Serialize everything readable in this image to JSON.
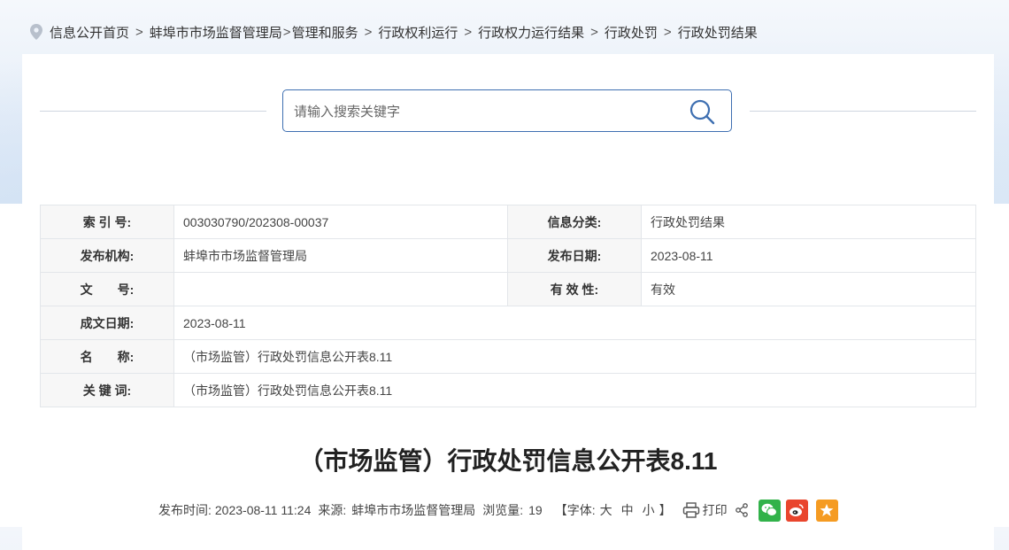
{
  "breadcrumb": {
    "items": [
      "信息公开首页",
      "蚌埠市市场监督管理局",
      "管理和服务",
      "行政权利运行",
      "行政权力运行结果",
      "行政处罚",
      "行政处罚结果"
    ],
    "separator": ">"
  },
  "search": {
    "placeholder": "请输入搜索关键字",
    "value": ""
  },
  "meta": {
    "index_label": "索 引 号:",
    "index_value": "003030790/202308-00037",
    "category_label": "信息分类:",
    "category_value": "行政处罚结果",
    "publisher_label": "发布机构:",
    "publisher_value": "蚌埠市市场监督管理局",
    "pubdate_label": "发布日期:",
    "pubdate_value": "2023-08-11",
    "docno_label": "文　　号:",
    "docno_value": "",
    "validity_label": "有 效 性:",
    "validity_value": "有效",
    "created_label": "成文日期:",
    "created_value": "2023-08-11",
    "name_label": "名　　称:",
    "name_value": "（市场监管）行政处罚信息公开表8.11",
    "keyword_label": "关 键 词:",
    "keyword_value": "（市场监管）行政处罚信息公开表8.11"
  },
  "article": {
    "title": "（市场监管）行政处罚信息公开表8.11",
    "publish_time_label": "发布时间:",
    "publish_time": "2023-08-11 11:24",
    "source_label": "来源:",
    "source": "蚌埠市市场监督管理局",
    "views_label": "浏览量:",
    "views": "19",
    "font_open": "【字体:",
    "font_large": "大",
    "font_medium": "中",
    "font_small": "小",
    "font_close": "】",
    "print_label": "打印"
  },
  "icons": [
    "location-pin-icon",
    "search-icon",
    "printer-icon",
    "share-icon",
    "wechat-icon",
    "weibo-icon",
    "favorite-star-icon"
  ],
  "colors": {
    "accent": "#3e6fb1",
    "wechat": "#32b24a",
    "weibo": "#e9452d",
    "favorite": "#f59b22"
  }
}
